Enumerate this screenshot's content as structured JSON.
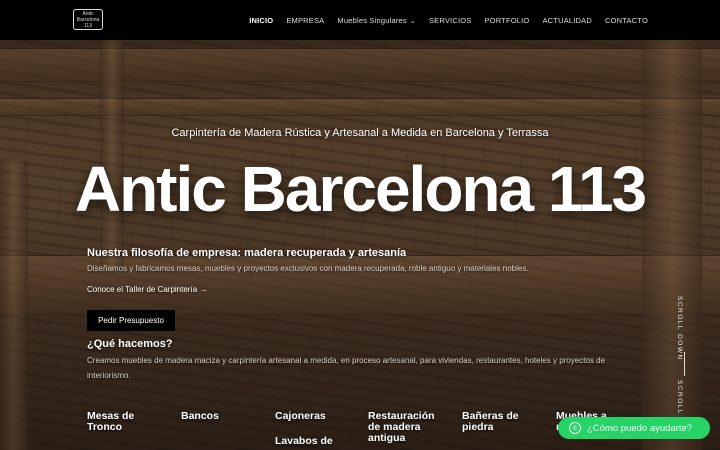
{
  "header": {
    "logo_text": "Antic Barcelona 113",
    "nav": [
      {
        "label": "INICIO"
      },
      {
        "label": "EMPRESA"
      },
      {
        "label": "Muebles Singulares"
      },
      {
        "label": "SERVICIOS"
      },
      {
        "label": "PORTFOLIO"
      },
      {
        "label": "ACTUALIDAD"
      },
      {
        "label": "CONTACTO"
      }
    ]
  },
  "hero": {
    "subtitle": "Carpintería de Madera Rústica y Artesanal a Medida en Barcelona y Terrassa",
    "title": "Antic Barcelona 113"
  },
  "philosophy": {
    "heading": "Nuestra filosofía de empresa: madera recuperada y artesanía",
    "text": "Diseñamos y fabricamos mesas, muebles y proyectos exclusivos con madera recuperada, roble antiguo y materiales nobles.",
    "link": "Conoce el Taller de Carpintería →"
  },
  "cta": {
    "label": "Pedir Presupuesto"
  },
  "what": {
    "heading": "¿Qué hacemos?",
    "text": "Creamos muebles de madera maciza y carpintería artesanal a medida, en proceso artesanal, para viviendas, restaurantes, hoteles y proyectos de interiorismo."
  },
  "categories": [
    "Mesas de Tronco",
    "Bancos",
    "Cajoneras",
    "Restauración de madera antigua",
    "Bañeras de piedra",
    "Muebles a medida",
    "Lavabos de"
  ],
  "scroll": {
    "label": "SCROLL DOWN",
    "label2": "SCROLL"
  },
  "whatsapp": {
    "label": "¿Cómo puedo ayudarte?"
  },
  "colors": {
    "header_bg": "#000000",
    "whatsapp": "#25d366"
  }
}
